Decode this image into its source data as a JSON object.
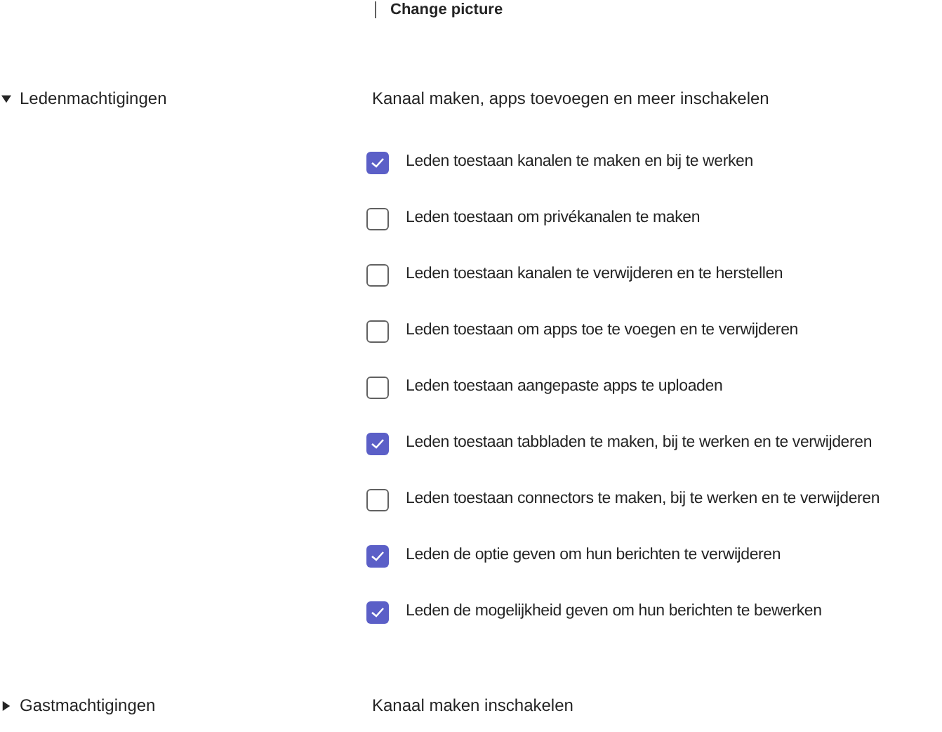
{
  "change_picture": {
    "label": "Change picture"
  },
  "sections": [
    {
      "title": "Ledenmachtigingen",
      "expanded": true,
      "description": "Kanaal maken, apps toevoegen en meer inschakelen",
      "options": [
        {
          "label": "Leden toestaan kanalen te maken en bij te werken",
          "checked": true
        },
        {
          "label": "Leden toestaan om privékanalen te maken",
          "checked": false
        },
        {
          "label": "Leden toestaan kanalen te verwijderen en te herstellen",
          "checked": false
        },
        {
          "label": "Leden toestaan om apps toe te voegen en te verwijderen",
          "checked": false
        },
        {
          "label": "Leden toestaan aangepaste apps te uploaden",
          "checked": false
        },
        {
          "label": "Leden toestaan tabbladen te maken, bij te werken en te verwijderen",
          "checked": true
        },
        {
          "label": "Leden toestaan connectors te maken, bij te werken en te verwijderen",
          "checked": false
        },
        {
          "label": "Leden de optie geven om hun berichten te verwijderen",
          "checked": true
        },
        {
          "label": "Leden de mogelijkheid geven om hun berichten te bewerken",
          "checked": true
        }
      ]
    },
    {
      "title": "Gastmachtigingen",
      "expanded": false,
      "description": "Kanaal maken inschakelen"
    }
  ]
}
